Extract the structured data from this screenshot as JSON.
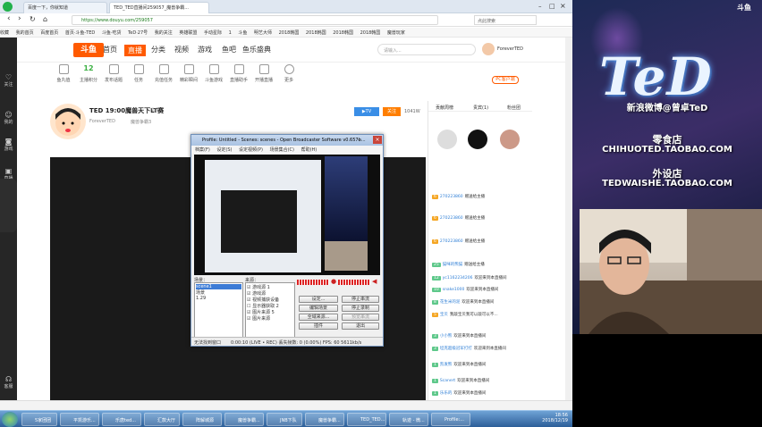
{
  "browser": {
    "tabs": [
      "百度一下，你就知道",
      "TED_TED直播间259057_魔兽争霸..."
    ],
    "url": "https://www.douyu.com/259057",
    "search_placeholder": "点此搜索",
    "bookmarks": [
      "收藏",
      "我的首页",
      "百度首页",
      "首页·斗鱼-TED",
      "斗鱼·吃货",
      "TeD·27号",
      "我的关注",
      "英雄联盟",
      "手动星际",
      "1",
      "斗鱼",
      "明艺大师",
      "2018韩国",
      "2018韩国",
      "2018韩国",
      "2018韩国",
      "魔兽玩家"
    ]
  },
  "rail": [
    "关注",
    "我的",
    "游戏",
    "直播",
    "客服"
  ],
  "header": {
    "logo": "斗鱼",
    "nav": [
      "首页",
      "直播",
      "分类",
      "视频",
      "游戏",
      "鱼吧",
      "鱼乐盛典"
    ],
    "search_placeholder": "请输入...",
    "user": "ForeverTED"
  },
  "tools": [
    {
      "label": "鱼丸值",
      "value": ""
    },
    {
      "label": "主播积分",
      "value": "12"
    },
    {
      "label": "发布话题",
      "value": ""
    },
    {
      "label": "任务",
      "value": ""
    },
    {
      "label": "充值任务",
      "value": ""
    },
    {
      "label": "精彩瞬间",
      "value": ""
    },
    {
      "label": "斗鱼游戏",
      "value": ""
    },
    {
      "label": "直播助手",
      "value": ""
    },
    {
      "label": "开播直播",
      "value": ""
    },
    {
      "label": "更多",
      "value": ""
    }
  ],
  "pc_button": "PC客户端",
  "room": {
    "title": "TED 19:00魔兽天下LT赛",
    "tag": "举报",
    "host": "ForeverTED",
    "category": "魔兽争霸3",
    "follow_label": "关注",
    "follow_count": "1041W"
  },
  "obs": {
    "title": "Profile: Untitled - Scenes: scenes - Open Broadcaster Software v0.657b...",
    "menu": [
      "档案(F)",
      "设定(S)",
      "设定视频(P)",
      "场景集合(C)",
      "帮助(H)"
    ],
    "scenes_label": "场景：",
    "scenes": [
      "scene1",
      "场景",
      "1.29"
    ],
    "sources_label": "来源：",
    "sources": [
      "游戏源 1",
      "游戏源",
      "视频捕获设备",
      "显示器获取 2",
      "图片来源 5",
      "图片来源"
    ],
    "buttons": [
      "设定...",
      "停止串流",
      "编辑场景",
      "停止录制",
      "全域来源...",
      "预览串流",
      "插件",
      "退出"
    ],
    "status_left": "无法找到窗口",
    "status_right": "0:00:10 (LIVE • REC)   丢失帧数: 0 (0.00%)   FPS: 60   5611kb/s"
  },
  "chat": {
    "tabs": [
      "贡献周榜",
      "贵宾(1)",
      "粉丝团"
    ],
    "lines": [
      {
        "lvl": "6",
        "nick": "270223860",
        "text": "赠送给主播"
      },
      {
        "lvl": "6",
        "nick": "270223860",
        "text": "赠送给主播"
      },
      {
        "lvl": "6",
        "nick": "270223860",
        "text": "赠送给主播"
      },
      {
        "lvl": "25",
        "nick": "猫咪的熊猫",
        "text": "赠送给主播"
      },
      {
        "lvl": "12",
        "nick": "yc1162234206",
        "text": "欢迎来到本直播间"
      },
      {
        "lvl": "10",
        "nick": "snake1000",
        "text": "欢迎来到本直播间"
      },
      {
        "lvl": "8",
        "nick": "花生米的泥",
        "text": "欢迎来到本直播间"
      },
      {
        "lvl": "5",
        "nick": "宝贝",
        "text": "我敲宝贝我可以敲可以不..."
      },
      {
        "lvl": "3",
        "nick": "小小熊",
        "text": "欢迎来到本直播间"
      },
      {
        "lvl": "3",
        "nick": "坦克超级冠军打打",
        "text": "欢迎来到本直播间"
      },
      {
        "lvl": "1",
        "nick": "凯发熊",
        "text": "欢迎来到本直播间"
      },
      {
        "lvl": "1",
        "nick": "Scanert",
        "text": "欢迎来到本直播间"
      },
      {
        "lvl": "1",
        "nick": "乐乐的",
        "text": "欢迎来到本直播间"
      }
    ]
  },
  "stream": {
    "logo": "TeD",
    "weibo": "新浪微博@曾卓TeD",
    "shop1_title": "零食店",
    "shop1_url": "CHIHUOTED.TAOBAO.COM",
    "shop2_title": "外设店",
    "shop2_url": "TEDWAISHE.TAOBAO.COM",
    "watermark": "斗鱼"
  },
  "taskbar": {
    "items": [
      "5家团团",
      "平凯游乐...",
      "乐唐ted...",
      "汇款大厅",
      "阵解城源",
      "魔兽争霸...",
      "JNB下队",
      "魔兽争霸...",
      "TED_TED...",
      "轨迹 - 微...",
      "Profile:..."
    ],
    "time": "18:56",
    "date": "2018/12/19"
  }
}
